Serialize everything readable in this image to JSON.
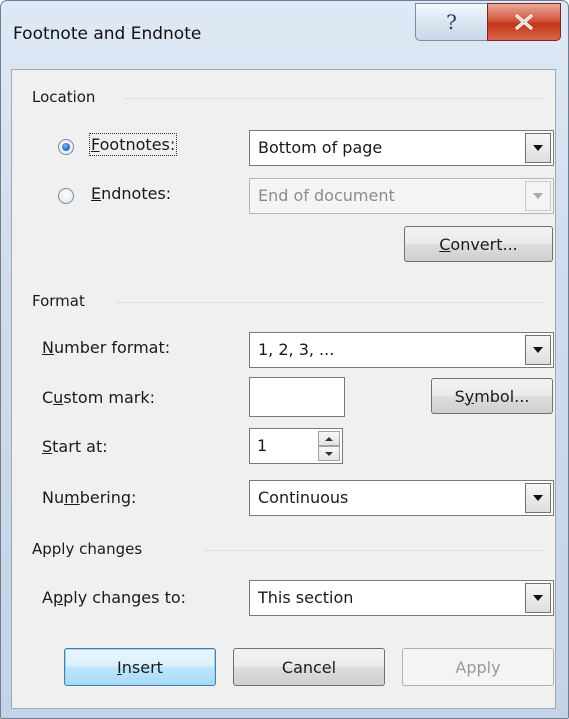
{
  "window": {
    "title": "Footnote and Endnote",
    "help_glyph": "?",
    "close_glyph": "x"
  },
  "location": {
    "section_label": "Location",
    "footnotes": {
      "label_prefix": "",
      "mnemonic": "F",
      "label_rest": "ootnotes:",
      "selected": true,
      "value": "Bottom of page"
    },
    "endnotes": {
      "mnemonic": "E",
      "label_rest": "ndnotes:",
      "selected": false,
      "value": "End of document"
    },
    "convert_button": {
      "mnemonic": "C",
      "rest": "onvert..."
    }
  },
  "format": {
    "section_label": "Format",
    "number_format": {
      "mnemonic": "N",
      "rest": "umber format:",
      "value": "1, 2, 3, ..."
    },
    "custom_mark": {
      "pre": "C",
      "mnemonic": "u",
      "rest": "stom mark:",
      "value": ""
    },
    "symbol_button": {
      "pre": "S",
      "mnemonic": "y",
      "rest": "mbol..."
    },
    "start_at": {
      "mnemonic": "S",
      "rest": "tart at:",
      "value": "1"
    },
    "numbering": {
      "pre": "Nu",
      "mnemonic": "m",
      "rest": "bering:",
      "value": "Continuous"
    }
  },
  "apply_changes": {
    "section_label": "Apply changes",
    "apply_to": {
      "pre": "A",
      "mnemonic": "p",
      "rest": "ply changes to:",
      "value": "This section"
    }
  },
  "buttons": {
    "insert": {
      "mnemonic": "I",
      "rest": "nsert"
    },
    "cancel": "Cancel",
    "apply": "Apply"
  }
}
